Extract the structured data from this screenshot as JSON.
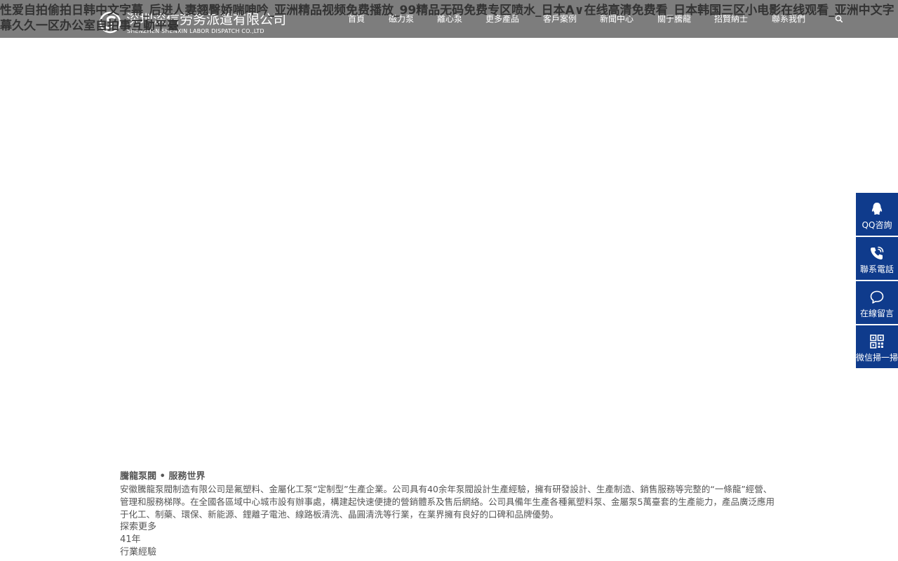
{
  "seo_title": "性爱自拍偷拍日韩中文字幕_后进人妻翘臀娇喘呻吟_亚洲精品视频免费播放_99精品无码免费专区喷水_日本A∨在线高清免费看_日本韩国三区小电影在线观看_亚洲中文字幕久久一区办公室自拍",
  "seo_title_suffix": "事互動平臺",
  "logo": {
    "name_cn": "深圳深信劳务派遣有限公司",
    "name_en": "SHENZHEN SHENXIN LABOR DISPATCH CO.,LTD"
  },
  "nav": {
    "items": [
      {
        "label": "首頁"
      },
      {
        "label": "磁力泵"
      },
      {
        "label": "離心泵"
      },
      {
        "label": "更多產品"
      },
      {
        "label": "客戶案例"
      },
      {
        "label": "新聞中心"
      },
      {
        "label": "關于騰龍"
      },
      {
        "label": "招賢納士"
      },
      {
        "label": "聯系我們"
      }
    ],
    "search_icon": "search-icon"
  },
  "float_bar": {
    "items": [
      {
        "label": "QQ咨詢",
        "icon": "qq-icon"
      },
      {
        "label": "聯系電話",
        "icon": "phone-icon"
      },
      {
        "label": "在線留言",
        "icon": "message-icon"
      },
      {
        "label": "微信掃一掃",
        "icon": "qrcode-icon"
      }
    ]
  },
  "about": {
    "heading": "騰龍泵閥 • 服務世界",
    "text": "安徽騰龍泵閥制造有限公司是氟塑料、金屬化工泵“定制型”生產企業。公司具有40余年泵閥設計生產經驗，擁有研發設計、生產制造、銷售服務等完整的“一條龍”經營、管理和服務梯隊。在全國各區域中心城市設有辦事處，構建起快速便捷的營銷體系及售后網絡。公司具備年生產各種氟塑料泵、金屬泵5萬臺套的生產能力，產品廣泛應用于化工、制藥、環保、新能源、鋰離子電池、線路板清洗、晶圓清洗等行業，在業界擁有良好的口碑和品牌優勢。",
    "more_label": "探索更多",
    "stat_value": "41年",
    "stat_label": "行業經驗"
  },
  "colors": {
    "header_bg": "#7d7d7d",
    "sidebar_bg": "#0f3b8c",
    "text": "#333333"
  }
}
